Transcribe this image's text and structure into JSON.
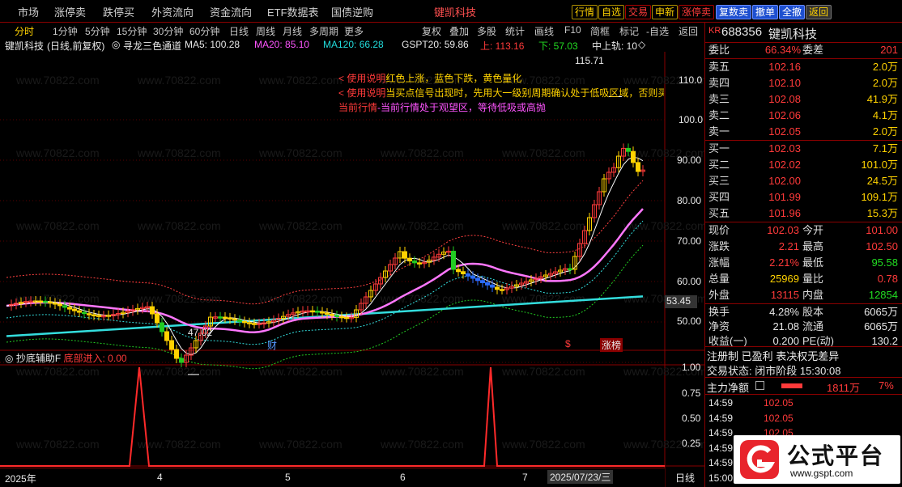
{
  "menu": {
    "items": [
      "市场",
      "涨停卖",
      "跌停买",
      "外资流向",
      "资金流向",
      "ETF数据表",
      "国债逆购"
    ],
    "highlight_items": [
      "涨停卖",
      "跌停买"
    ],
    "extra_items": [
      "键凯科技"
    ],
    "buttons": [
      "行情",
      "自选",
      "交易",
      "申新",
      "涨停卖",
      "复数卖",
      "撤单",
      "全撤",
      "返回"
    ]
  },
  "period_bar": {
    "tabs": [
      "分时",
      "1分钟",
      "5分钟",
      "15分钟",
      "30分钟",
      "60分钟",
      "日线",
      "周线",
      "月线",
      "多周期",
      "更多"
    ],
    "tools": [
      "复权",
      "叠加",
      "多股",
      "统计",
      "画线",
      "F10",
      "简框",
      "标记",
      "-自选",
      "返回"
    ]
  },
  "indicator_bar": {
    "stock": "键凯科技",
    "mode": "(日线,前复权)",
    "indicator": "寻龙三色通道",
    "ma5": "MA5: 100.28",
    "ma20": "MA20: 85.10",
    "ma120": "MA120: 66.28",
    "gspt": "GSPT20: 59.86",
    "up": "上: 113.16",
    "down": "下: 57.03",
    "mid": "中上轨: 10"
  },
  "notes": [
    {
      "prefix": "< 使用说明",
      "text": "红色上涨，蓝色下跌，黄色量化"
    },
    {
      "prefix": "< 使用说明",
      "text": "当买点信号出现时，先用大一级别周期确认处于低吸区域，否则买"
    },
    {
      "prefix": "当前行情",
      "text": "-当前行情处于观望区，等待低吸或高抛"
    }
  ],
  "price_axis": [
    "110.0",
    "100.0",
    "90.00",
    "80.00",
    "70.00",
    "60.00",
    "50.00"
  ],
  "price_marker": "53.45",
  "annotations": {
    "high": "115.71",
    "low": "47.02",
    "cai": "财",
    "s": "$",
    "zhangbang": "涨榜"
  },
  "sub_chart": {
    "title": "抄底辅助F",
    "value_label": "底部进入: 0.00",
    "axis": [
      "1.00",
      "0.75",
      "0.50",
      "0.25"
    ]
  },
  "x_axis": {
    "labels": [
      "2025年",
      "4",
      "5",
      "6",
      "7"
    ],
    "cursor_date": "2025/07/23/三",
    "period": "日线"
  },
  "quote": {
    "badge": "KR",
    "code": "688356",
    "name": "键凯科技",
    "weibi_label": "委比",
    "weibi": "66.34%",
    "weicha_label": "委差",
    "weicha": "201",
    "sell": [
      {
        "label": "卖五",
        "price": "102.16",
        "vol": "2.0万"
      },
      {
        "label": "卖四",
        "price": "102.10",
        "vol": "2.0万"
      },
      {
        "label": "卖三",
        "price": "102.08",
        "vol": "41.9万"
      },
      {
        "label": "卖二",
        "price": "102.06",
        "vol": "4.1万"
      },
      {
        "label": "卖一",
        "price": "102.05",
        "vol": "2.0万"
      }
    ],
    "buy": [
      {
        "label": "买一",
        "price": "102.03",
        "vol": "7.1万"
      },
      {
        "label": "买二",
        "price": "102.02",
        "vol": "101.0万"
      },
      {
        "label": "买三",
        "price": "102.00",
        "vol": "24.5万"
      },
      {
        "label": "买四",
        "price": "101.99",
        "vol": "109.1万"
      },
      {
        "label": "买五",
        "price": "101.96",
        "vol": "15.3万"
      }
    ],
    "stats": [
      {
        "l1": "现价",
        "v1": "102.03",
        "l2": "今开",
        "v2": "101.00"
      },
      {
        "l1": "涨跌",
        "v1": "2.21",
        "l2": "最高",
        "v2": "102.50"
      },
      {
        "l1": "涨幅",
        "v1": "2.21%",
        "l2": "最低",
        "v2": "95.58"
      },
      {
        "l1": "总量",
        "v1": "25969",
        "l2": "量比",
        "v2": "0.78"
      },
      {
        "l1": "外盘",
        "v1": "13115",
        "l2": "内盘",
        "v2": "12854"
      }
    ],
    "stats2": [
      {
        "l1": "换手",
        "v1": "4.28%",
        "l2": "股本",
        "v2": "6065万"
      },
      {
        "l1": "净资",
        "v1": "21.08",
        "l2": "流通",
        "v2": "6065万"
      },
      {
        "l1": "收益(一)",
        "v1": "0.200",
        "l2": "PE(动)",
        "v2": "130.2"
      }
    ],
    "tags": "注册制 已盈利 表决权无差异",
    "status": "交易状态: 闭市阶段 15:30:08",
    "main_flow_label": "主力净额",
    "main_flow": "1811万",
    "main_flow_pct": "7%",
    "ticks": [
      {
        "time": "14:59",
        "price": "102.05"
      },
      {
        "time": "14:59",
        "price": "102.05"
      },
      {
        "time": "14:59",
        "price": "102.05"
      },
      {
        "time": "14:59",
        "price": ""
      },
      {
        "time": "14:59",
        "price": ""
      },
      {
        "time": "15:00",
        "price": ""
      }
    ]
  },
  "watermark": "www.70822.com",
  "logo": {
    "title": "公式平台",
    "url": "www.gspt.com"
  },
  "colors": {
    "up": "#ff3a3a",
    "down": "#2a6cff",
    "neutral": "#ffd200",
    "ma5": "#ffffff",
    "ma20": "#ff77ff",
    "ma120": "#33dddd",
    "band_upper": "#ff4040",
    "band_mid": "#33dddd",
    "band_lower": "#22cc22"
  }
}
